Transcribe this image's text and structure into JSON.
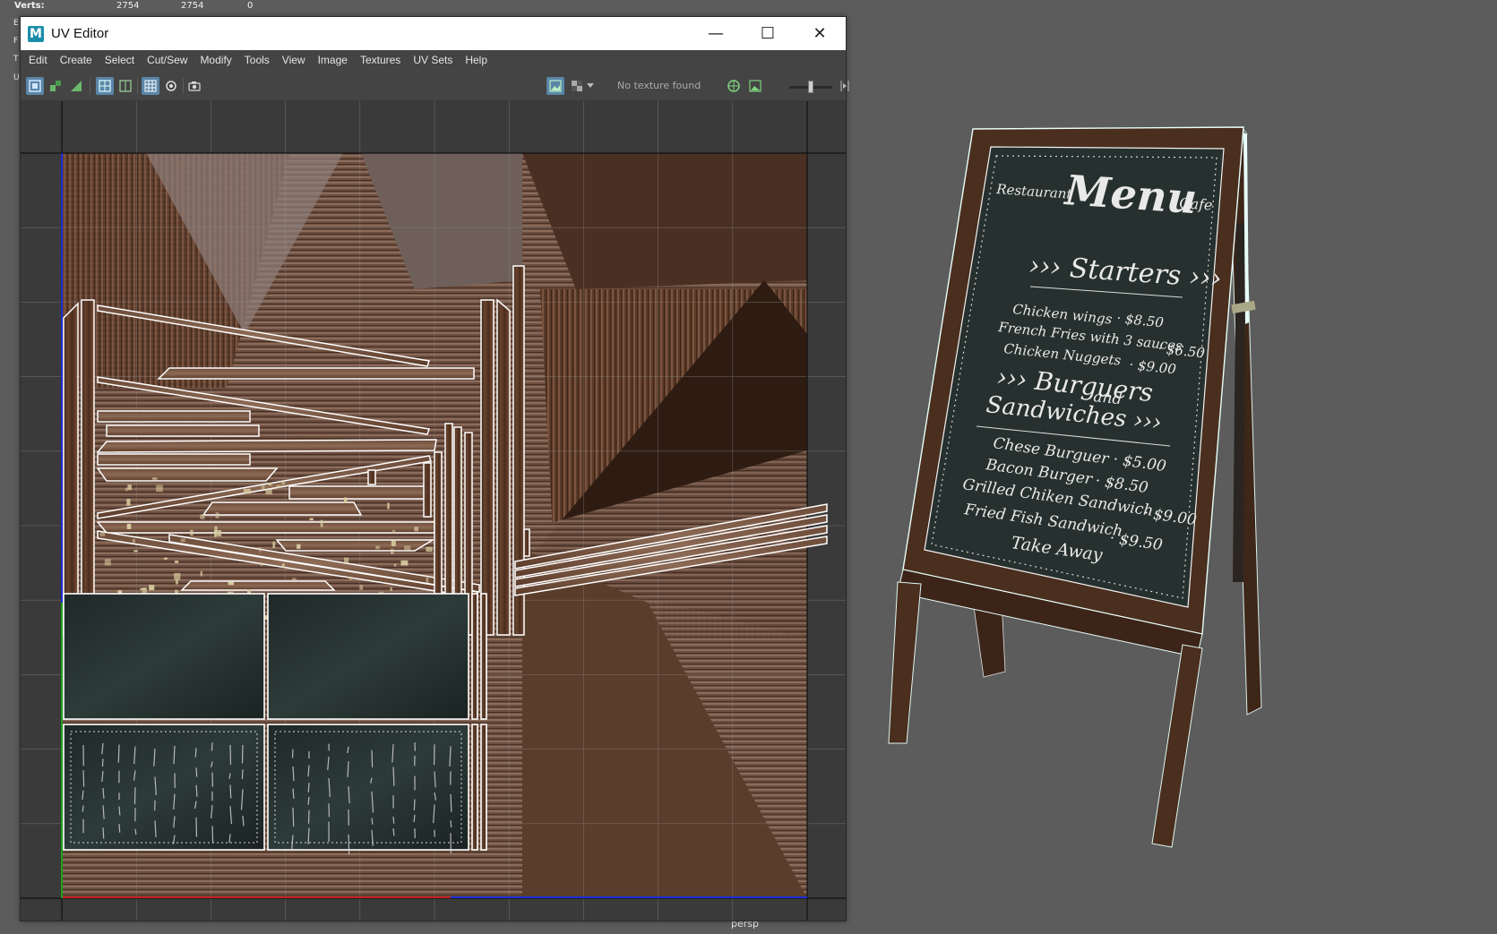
{
  "hud": {
    "verts_label": "Verts:",
    "verts_values": [
      "2754",
      "2754",
      "0"
    ],
    "side_letters": [
      "E",
      "F",
      "T",
      "U"
    ]
  },
  "viewport": {
    "camera_label": "persp"
  },
  "window": {
    "title": "UV Editor",
    "app_icon": "M",
    "controls": {
      "minimize": "—",
      "maximize": "☐",
      "close": "✕"
    }
  },
  "menu": [
    "Edit",
    "Create",
    "Select",
    "Cut/Sew",
    "Modify",
    "Tools",
    "View",
    "Image",
    "Textures",
    "UV Sets",
    "Help"
  ],
  "toolbar": {
    "texture_status": "No texture found",
    "exposure_level": 0.5
  },
  "chalkboard": {
    "left_tag": "Restaurant",
    "title": "Menu",
    "right_tag": "Cafe",
    "section1": "››› Starters ›››",
    "starters": [
      {
        "name": "Chicken wings",
        "price": "· $8.50"
      },
      {
        "name": "French Fries with 3 sauces",
        "price": "· $6.50"
      },
      {
        "name": "Chicken Nuggets",
        "price": "· $9.00"
      }
    ],
    "section2a": "››› Burguers",
    "section2b": "and",
    "section2c": "Sandwiches ›››",
    "mains": [
      {
        "name": "Chese Burguer",
        "price": "· $5.00"
      },
      {
        "name": "Bacon Burger",
        "price": "· $8.50"
      },
      {
        "name": "Grilled Chiken Sandwich",
        "price": "· $9.00"
      },
      {
        "name": "Fried Fish Sandwich",
        "price": "· $9.50"
      }
    ],
    "footer": "Take Away"
  },
  "colors": {
    "titlebar": "#ffffff",
    "panel": "#444444",
    "viewport_bg": "#5c5c5c",
    "wood": "#4a2e1e",
    "chalk": "#26302e",
    "toggle_active": "#5a86a8"
  }
}
